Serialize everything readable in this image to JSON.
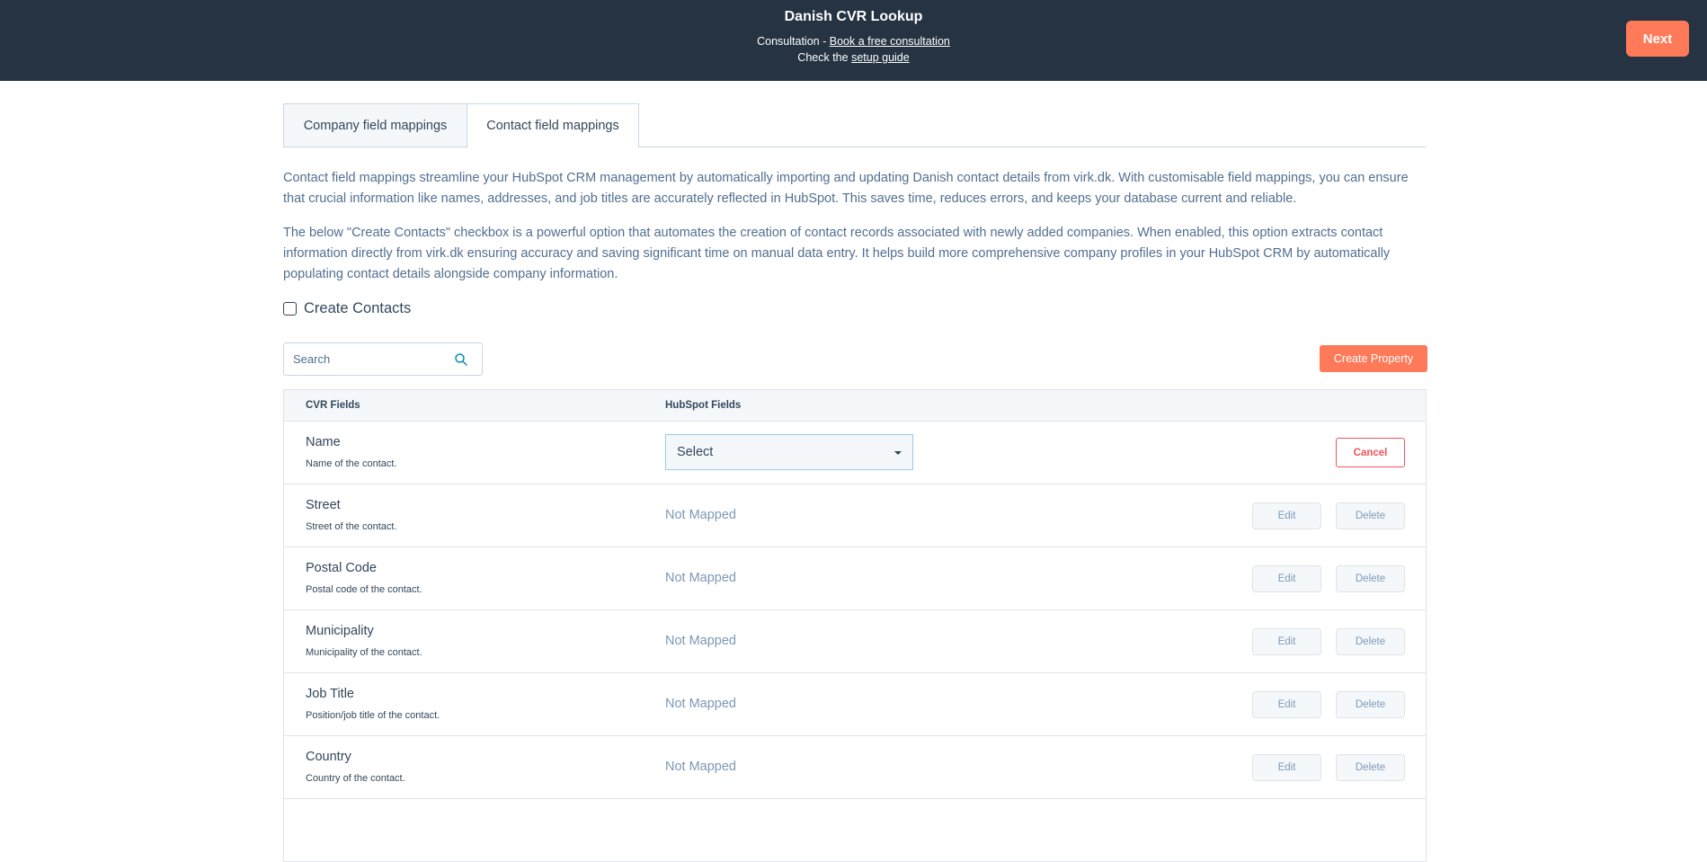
{
  "header": {
    "title": "Danish CVR Lookup",
    "consultation_prefix": "Consultation - ",
    "consultation_link": "Book a free consultation",
    "guide_prefix": "Check the ",
    "guide_link": "setup guide",
    "next_label": "Next"
  },
  "tabs": [
    {
      "label": "Company field mappings",
      "active": false
    },
    {
      "label": "Contact field mappings",
      "active": true
    }
  ],
  "description": {
    "p1": "Contact field mappings streamline your HubSpot CRM management by automatically importing and updating Danish contact details from virk.dk. With customisable field mappings, you can ensure that crucial information like names, addresses, and job titles are accurately reflected in HubSpot. This saves time, reduces errors, and keeps your database current and reliable.",
    "p2": "The below \"Create Contacts\" checkbox is a powerful option that automates the creation of contact records associated with newly added companies. When enabled, this option extracts contact information directly from virk.dk ensuring accuracy and saving significant time on manual data entry. It helps build more comprehensive company profiles in your HubSpot CRM by automatically populating contact details alongside company information."
  },
  "create_contacts": {
    "label": "Create Contacts",
    "checked": false
  },
  "search": {
    "placeholder": "Search",
    "value": ""
  },
  "create_property_label": "Create Property",
  "table": {
    "headers": {
      "cvr": "CVR Fields",
      "hubspot": "HubSpot Fields"
    },
    "editing_row": {
      "name": "Name",
      "description": "Name of the contact.",
      "select_value": "Select",
      "cancel_label": "Cancel"
    },
    "rows": [
      {
        "name": "Street",
        "description": "Street of the contact.",
        "mapping": "Not Mapped"
      },
      {
        "name": "Postal Code",
        "description": "Postal code of the contact.",
        "mapping": "Not Mapped"
      },
      {
        "name": "Municipality",
        "description": "Municipality of the contact.",
        "mapping": "Not Mapped"
      },
      {
        "name": "Job Title",
        "description": "Position/job title of the contact.",
        "mapping": "Not Mapped"
      },
      {
        "name": "Country",
        "description": "Country of the contact.",
        "mapping": "Not Mapped"
      }
    ],
    "edit_label": "Edit",
    "delete_label": "Delete"
  },
  "colors": {
    "header_bg": "#253342",
    "accent": "#ff7a59",
    "danger": "#f2545b",
    "muted_text": "#7c98b6"
  }
}
